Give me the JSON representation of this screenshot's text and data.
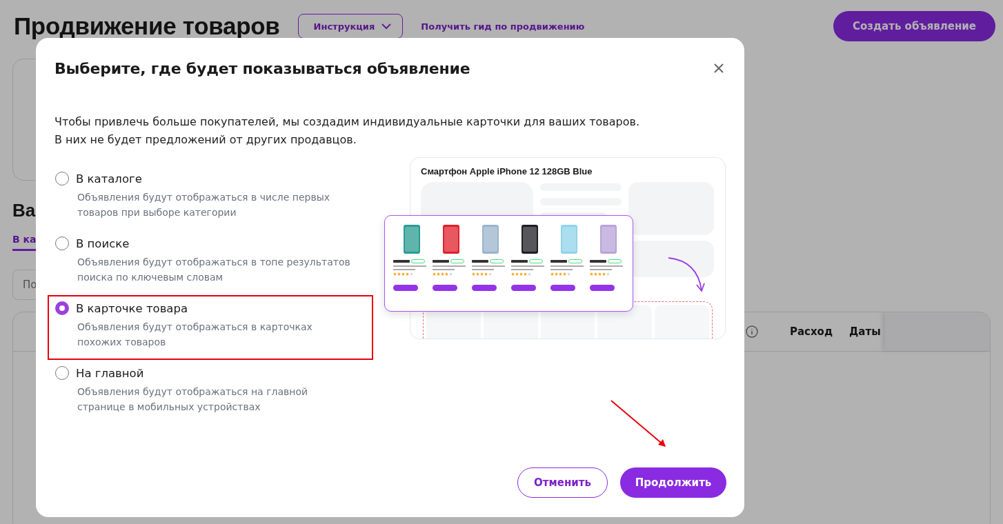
{
  "page": {
    "title": "Продвижение товаров",
    "guide_button": "Инструкция",
    "guide_link": "Получить гид по продвижению",
    "create_button": "Создать объявление",
    "section_heading": "Ва",
    "tab": "В ка",
    "search": {
      "placeholder": "По"
    },
    "table": {
      "columns": [
        "Расход",
        "Даты"
      ]
    }
  },
  "modal": {
    "title": "Выберите, где будет показываться объявление",
    "description": "Чтобы привлечь больше покупателей, мы создадим индивидуальные карточки для ваших товаров.\nВ них не будет предложений от других продавцов.",
    "options": [
      {
        "label": "В каталоге",
        "hint": "Объявления будут отображаться в числе первых товаров при выборе категории",
        "selected": false,
        "highlighted": false
      },
      {
        "label": "В поиске",
        "hint": "Объявления будут отображаться в топе результатов поиска по ключевым словам",
        "selected": false,
        "highlighted": false
      },
      {
        "label": "В карточке товара",
        "hint": "Объявления будут отображаться в карточках похожих товаров",
        "selected": true,
        "highlighted": true
      },
      {
        "label": "На главной",
        "hint": "Объявления будут отображаться на главной странице в мобильных устройствах",
        "selected": false,
        "highlighted": false
      }
    ],
    "preview": {
      "product_title": "Смартфон Apple iPhone 12 128GB Blue",
      "products": [
        {
          "stars": 4,
          "color": "#2a9d8f"
        },
        {
          "stars": 4,
          "color": "#e0202b"
        },
        {
          "stars": 4,
          "color": "#9bb4cc"
        },
        {
          "stars": 4,
          "color": "#1e1e24"
        },
        {
          "stars": 4,
          "color": "#8fd3ea"
        },
        {
          "stars": 4,
          "color": "#b9a3d9"
        }
      ]
    },
    "cancel_button": "Отменить",
    "continue_button": "Продолжить",
    "annotation_arrow": true
  }
}
